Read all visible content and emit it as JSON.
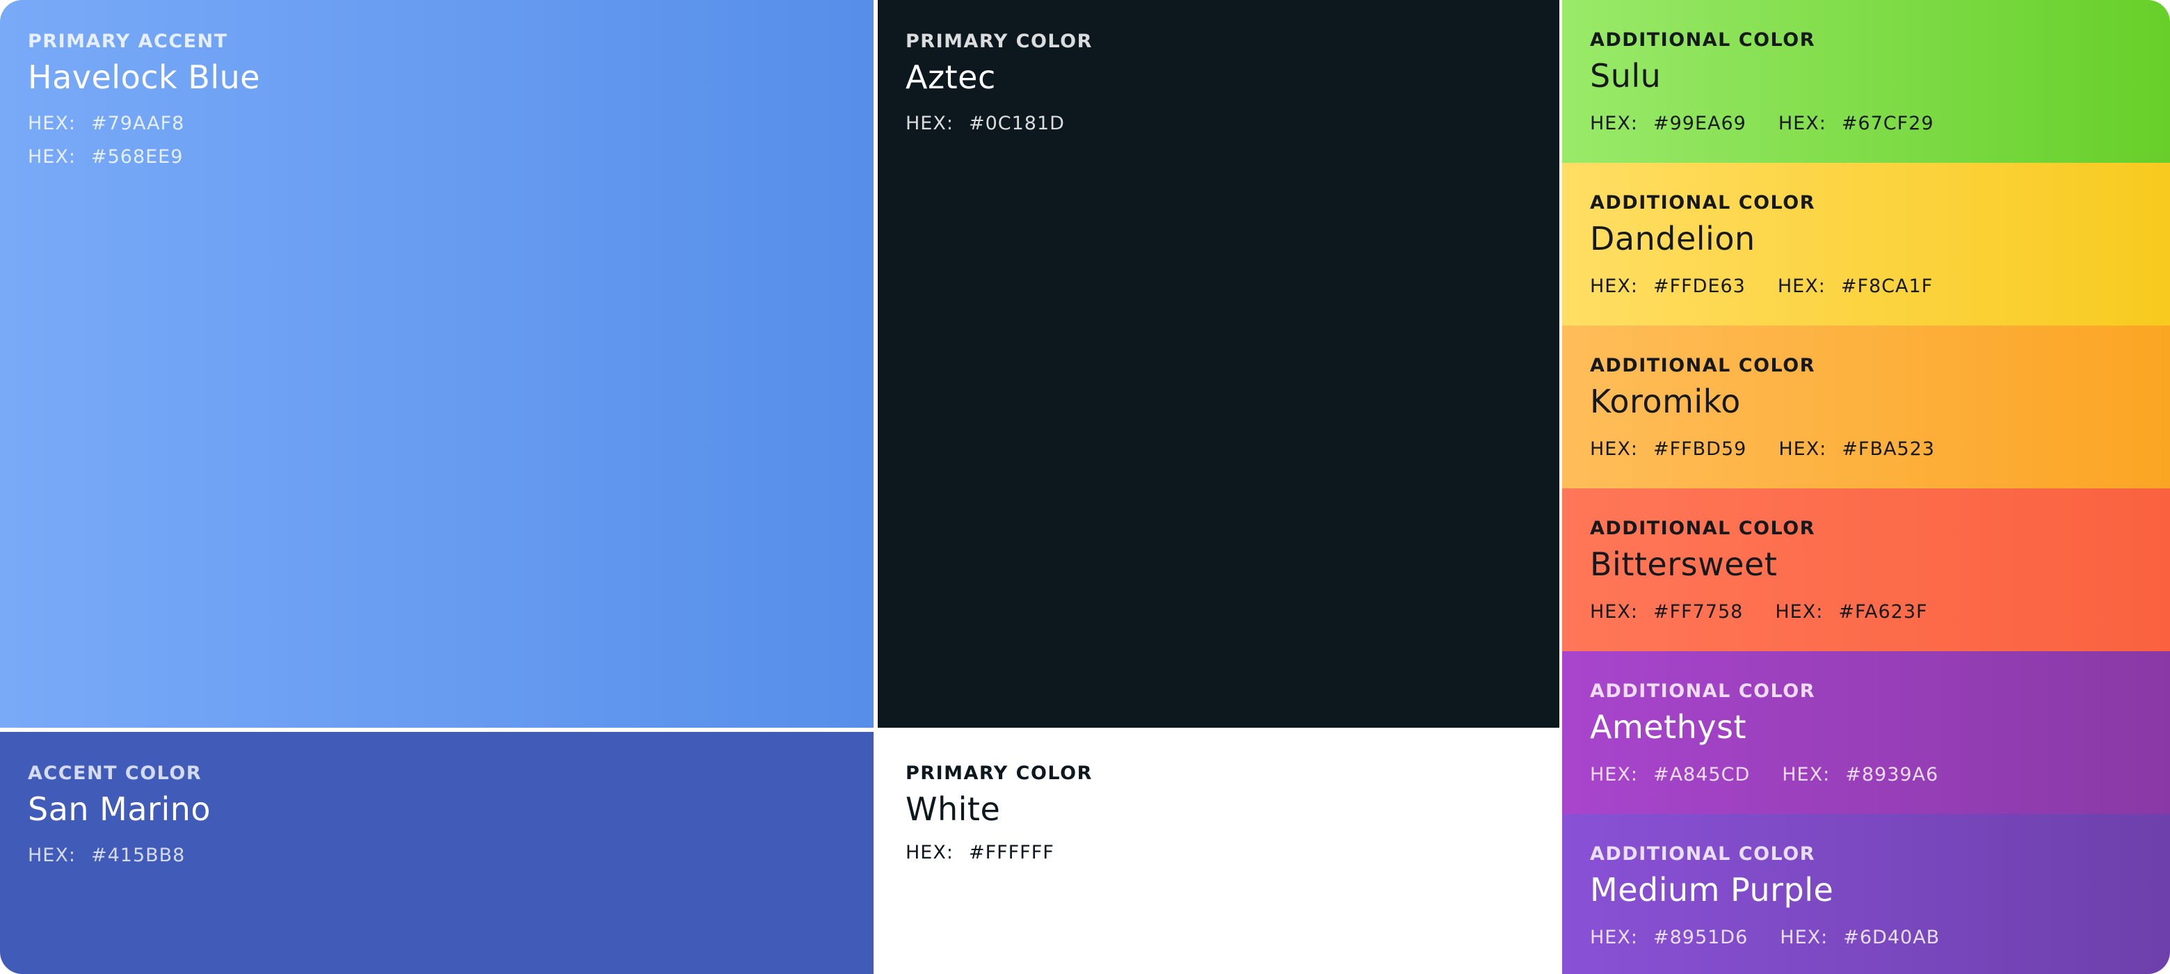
{
  "hex_key": "HEX:",
  "swatches": {
    "havelock": {
      "label": "PRIMARY ACCENT",
      "name": "Havelock Blue",
      "hex1": "#79AAF8",
      "hex2": "#568EE9"
    },
    "sanmarino": {
      "label": "ACCENT COLOR",
      "name": "San Marino",
      "hex1": "#415BB8"
    },
    "aztec": {
      "label": "PRIMARY COLOR",
      "name": "Aztec",
      "hex1": "#0C181D"
    },
    "white": {
      "label": "PRIMARY COLOR",
      "name": "White",
      "hex1": "#FFFFFF"
    },
    "sulu": {
      "label": "ADDITIONAL COLOR",
      "name": "Sulu",
      "hex1": "#99EA69",
      "hex2": "#67CF29"
    },
    "dandelion": {
      "label": "ADDITIONAL COLOR",
      "name": "Dandelion",
      "hex1": "#FFDE63",
      "hex2": "#F8CA1F"
    },
    "koromiko": {
      "label": "ADDITIONAL COLOR",
      "name": "Koromiko",
      "hex1": "#FFBD59",
      "hex2": "#FBA523"
    },
    "bittersweet": {
      "label": "ADDITIONAL COLOR",
      "name": "Bittersweet",
      "hex1": "#FF7758",
      "hex2": "#FA623F"
    },
    "amethyst": {
      "label": "ADDITIONAL COLOR",
      "name": "Amethyst",
      "hex1": "#A845CD",
      "hex2": "#8939A6"
    },
    "mediumpurple": {
      "label": "ADDITIONAL COLOR",
      "name": "Medium Purple",
      "hex1": "#8951D6",
      "hex2": "#6D40AB"
    }
  }
}
